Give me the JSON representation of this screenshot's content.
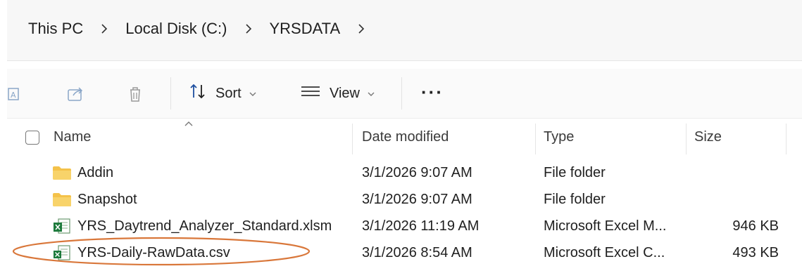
{
  "breadcrumb": {
    "items": [
      "This PC",
      "Local Disk (C:)",
      "YRSDATA"
    ]
  },
  "toolbar": {
    "sort_label": "Sort",
    "view_label": "View",
    "more_label": "···"
  },
  "columns": {
    "name": "Name",
    "date": "Date modified",
    "type": "Type",
    "size": "Size"
  },
  "files": [
    {
      "name": "Addin",
      "date": "3/1/2026 9:07 AM",
      "type": "File folder",
      "size": "",
      "icon": "folder-icon"
    },
    {
      "name": "Snapshot",
      "date": "3/1/2026 9:07 AM",
      "type": "File folder",
      "size": "",
      "icon": "folder-icon"
    },
    {
      "name": "YRS_Daytrend_Analyzer_Standard.xlsm",
      "date": "3/1/2026 11:19 AM",
      "type": "Microsoft Excel M...",
      "size": "946 KB",
      "icon": "excel-macro-file-icon"
    },
    {
      "name": "YRS-Daily-RawData.csv",
      "date": "3/1/2026 8:54 AM",
      "type": "Microsoft Excel C...",
      "size": "493 KB",
      "icon": "excel-csv-file-icon"
    }
  ],
  "colors": {
    "highlight": "#d9773a",
    "folder": "#f4c24a",
    "excel": "#1d7a3c"
  }
}
